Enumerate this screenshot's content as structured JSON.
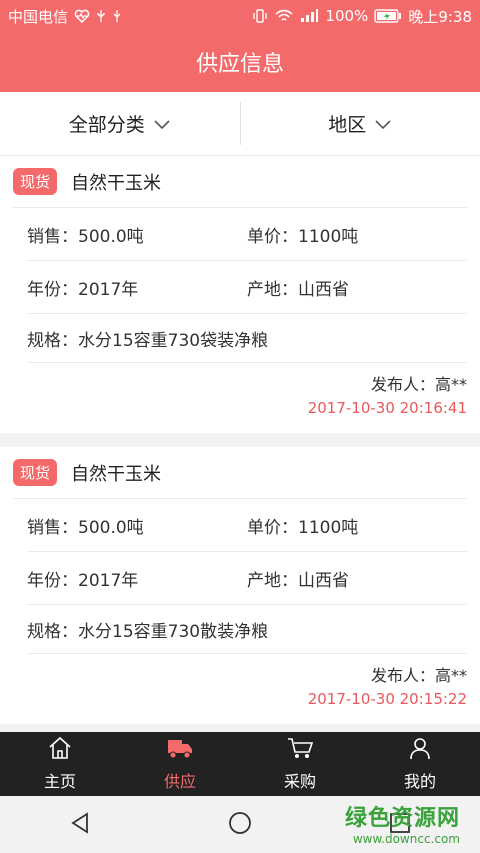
{
  "status": {
    "carrier": "中国电信",
    "battery": "100%",
    "time": "晚上9:38"
  },
  "header": {
    "title": "供应信息"
  },
  "filters": [
    {
      "label": "全部分类"
    },
    {
      "label": "地区"
    }
  ],
  "listings": [
    {
      "tag": "现货",
      "product": "自然干玉米",
      "sales": "销售：500.0吨",
      "price": "单价：1100吨",
      "year": "年份：2017年",
      "origin": "产地：山西省",
      "spec": "规格：水分15容重730袋装净粮",
      "publisher": "发布人：高**",
      "time": "2017-10-30 20:16:41"
    },
    {
      "tag": "现货",
      "product": "自然干玉米",
      "sales": "销售：500.0吨",
      "price": "单价：1100吨",
      "year": "年份：2017年",
      "origin": "产地：山西省",
      "spec": "规格：水分15容重730散装净粮",
      "publisher": "发布人：高**",
      "time": "2017-10-30 20:15:22"
    }
  ],
  "tabs": [
    {
      "label": "主页",
      "icon": "home-icon"
    },
    {
      "label": "供应",
      "icon": "truck-icon"
    },
    {
      "label": "采购",
      "icon": "cart-icon"
    },
    {
      "label": "我的",
      "icon": "person-icon"
    }
  ],
  "watermark": {
    "main": "绿色资源网",
    "sub": "www.downcc.com"
  },
  "colors": {
    "accent": "#f46a6a",
    "time": "#e9585b",
    "tabbar": "#222222"
  }
}
